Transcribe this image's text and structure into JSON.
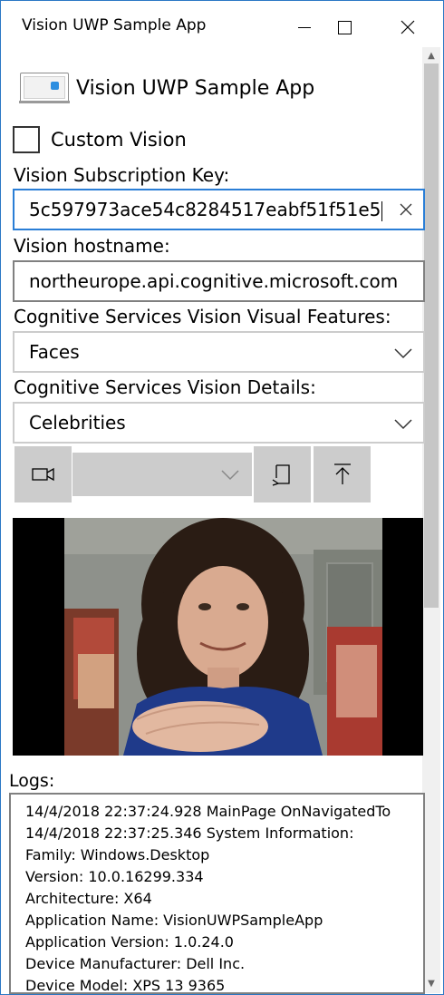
{
  "window": {
    "title": "Vision UWP Sample App"
  },
  "header": {
    "app_title": "Vision UWP Sample App"
  },
  "custom_vision": {
    "label": "Custom Vision",
    "checked": false
  },
  "subscription_key": {
    "label": "Vision Subscription Key:",
    "value": "5c597973ace54c8284517eabf51f51e5"
  },
  "hostname": {
    "label": "Vision hostname:",
    "value": "northeurope.api.cognitive.microsoft.com"
  },
  "visual_features": {
    "label": "Cognitive Services Vision Visual Features:",
    "selected": "Faces"
  },
  "details": {
    "label": "Cognitive Services Vision Details:",
    "selected": "Celebrities"
  },
  "toolbar": {
    "camera_icon": "video-camera-icon",
    "camera_select_value": "",
    "rotate_icon": "rotate-icon",
    "upload_icon": "upload-icon"
  },
  "logs": {
    "label": "Logs:",
    "lines": [
      "14/4/2018 22:37:24.928 MainPage OnNavigatedTo",
      "14/4/2018 22:37:25.346 System Information:",
      "Family: Windows.Desktop",
      "Version: 10.0.16299.334",
      "Architecture: X64",
      "Application Name: VisionUWPSampleApp",
      "Application Version: 1.0.24.0",
      "Device Manufacturer: Dell Inc.",
      "Device Model: XPS 13 9365"
    ]
  },
  "colors": {
    "accent": "#2a7ed6",
    "control_bg": "#cccccc",
    "border": "#808080"
  }
}
